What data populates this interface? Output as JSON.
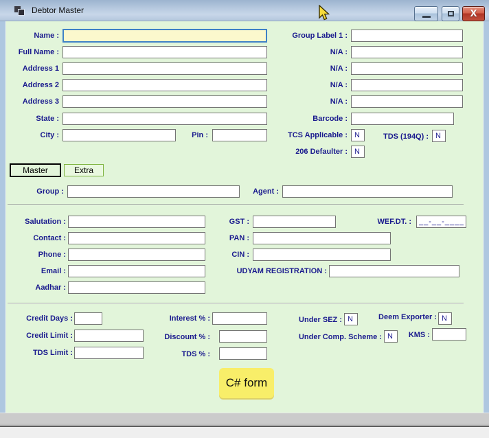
{
  "window": {
    "title": "Debtor Master"
  },
  "identity": {
    "name_label": "Name :",
    "full_name_label": "Full Name :",
    "address1_label": "Address 1",
    "address2_label": "Address 2",
    "address3_label": "Address 3",
    "state_label": "State :",
    "city_label": "City :",
    "pin_label": "Pin :"
  },
  "right_top": {
    "group_label1_label": "Group Label 1 :",
    "na1_label": "N/A :",
    "na2_label": "N/A :",
    "na3_label": "N/A :",
    "na4_label": "N/A :",
    "barcode_label": "Barcode :",
    "tcs_applicable_label": "TCS Applicable :",
    "tcs_applicable_value": "N",
    "tds_194q_label": "TDS (194Q) :",
    "tds_194q_value": "N",
    "defaulter_206_label": "206 Defaulter :",
    "defaulter_206_value": "N"
  },
  "tabs": {
    "master": "Master",
    "extra": "Extra"
  },
  "grouping": {
    "group_label": "Group :",
    "agent_label": "Agent :"
  },
  "details": {
    "salutation_label": "Salutation :",
    "contact_label": "Contact :",
    "phone_label": "Phone :",
    "email_label": "Email :",
    "aadhar_label": "Aadhar :",
    "gst_label": "GST :",
    "pan_label": "PAN :",
    "cin_label": "CIN :",
    "udyam_label": "UDYAM REGISTRATION :",
    "wef_dt_label": "WEF.DT. :",
    "wef_dt_value": "__-__-____"
  },
  "terms": {
    "credit_days_label": "Credit Days :",
    "credit_limit_label": "Credit Limit :",
    "tds_limit_label": "TDS Limit :",
    "interest_label": "Interest % :",
    "discount_label": "Discount % :",
    "tds_pct_label": "TDS % :",
    "under_sez_label": "Under SEZ :",
    "under_sez_value": "N",
    "deem_exporter_label": "Deem Exporter :",
    "deem_exporter_value": "N",
    "under_comp_label": "Under Comp. Scheme :",
    "under_comp_value": "N",
    "kms_label": "KMS :"
  },
  "footer": {
    "csharp_button_label": "C# form"
  },
  "colors": {
    "client_bg": "#e2f5da",
    "label_navy": "#1a1a8e",
    "focused_input_bg": "#fbf8cd",
    "focused_input_border": "#3f81c6",
    "button_yellow": "#f8ee69",
    "close_red": "#b03526"
  }
}
